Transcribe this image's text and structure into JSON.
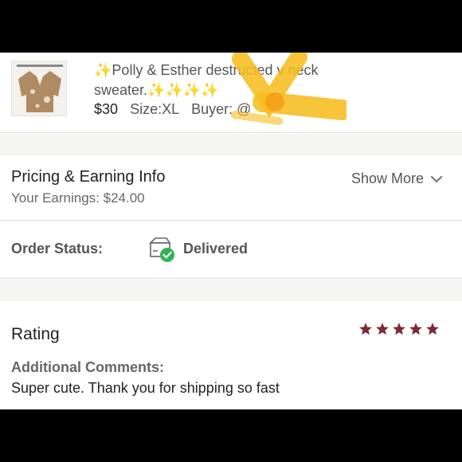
{
  "listing": {
    "title_line1_icon": "✨",
    "title_line1_text": "Polly & Esther destructed v neck",
    "title_line2_text": "sweater.",
    "title_line2_icons": "✨✨✨✨",
    "price": "$30",
    "size": "Size:XL",
    "buyer": "Buyer: @"
  },
  "pricing": {
    "title": "Pricing & Earning Info",
    "earnings": "Your Earnings: $24.00",
    "show_more": "Show More"
  },
  "order_status": {
    "label": "Order Status:",
    "value": "Delivered"
  },
  "rating": {
    "title": "Rating",
    "stars": 5,
    "star_color": "#7d2a35",
    "comments_label": "Additional Comments:",
    "comments_text": "Super cute. Thank you for shipping so fast"
  },
  "colors": {
    "delivered_check": "#2fb457",
    "sparkle": "#f3c227",
    "redaction": "#f6bd1f"
  }
}
